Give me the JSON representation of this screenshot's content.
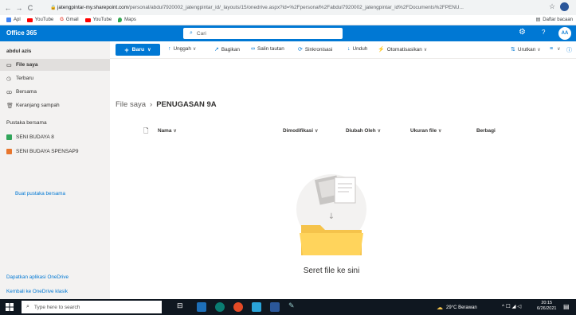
{
  "browser": {
    "url_host": "jatengpintar-my.sharepoint.com",
    "url_path": "/personal/abdul7920002_jatengpintar_id/_layouts/15/onedrive.aspx?id=%2Fpersonal%2Fabdul7920002_jatengpintar_id%2FDocuments%2FPENU...",
    "bookmarks": [
      {
        "label": "Apl",
        "color": "#4285f4"
      },
      {
        "label": "YouTube",
        "color": "#ff0000"
      },
      {
        "label": "Gmail",
        "color": "#ea4335"
      },
      {
        "label": "YouTube",
        "color": "#ff0000"
      },
      {
        "label": "Maps",
        "color": "#34a853"
      }
    ],
    "reading_list": "Daftar bacaan"
  },
  "header": {
    "title": "Office 365",
    "search_placeholder": "Cari",
    "avatar_initials": "AA",
    "accent": "#0078d4"
  },
  "sidebar": {
    "user": "abdul azis",
    "items": [
      {
        "label": "File saya",
        "icon": "folder-icon"
      },
      {
        "label": "Terbaru",
        "icon": "clock-icon"
      },
      {
        "label": "Bersama",
        "icon": "people-icon"
      },
      {
        "label": "Keranjang sampah",
        "icon": "trash-icon"
      }
    ],
    "shared_heading": "Pustaka bersama",
    "libraries": [
      {
        "label": "SENI BUDAYA 8",
        "color": "#31a55a"
      },
      {
        "label": "SENI BUDAYA SPENSAP9",
        "color": "#e8762d"
      }
    ],
    "create_link": "Buat pustaka bersama",
    "bottom_links": [
      "Dapatkan aplikasi OneDrive",
      "Kembali ke OneDrive klasik"
    ]
  },
  "commands": {
    "new": "Baru",
    "upload": "Unggah",
    "share": "Bagikan",
    "copy_link": "Salin tautan",
    "sync": "Sinkronisasi",
    "download": "Unduh",
    "automate": "Otomatisasikan",
    "sort": "Urutkan"
  },
  "breadcrumb": {
    "root": "File saya",
    "current": "PENUGASAN 9A"
  },
  "columns": {
    "name": "Nama",
    "modified": "Dimodifikasi",
    "modified_by": "Diubah Oleh",
    "size": "Ukuran file",
    "sharing": "Berbagi"
  },
  "empty_state": {
    "text": "Seret file ke sini"
  },
  "taskbar": {
    "search_placeholder": "Type here to search",
    "weather": "29°C Berawan",
    "time": "20:15",
    "date": "6/26/2021"
  }
}
